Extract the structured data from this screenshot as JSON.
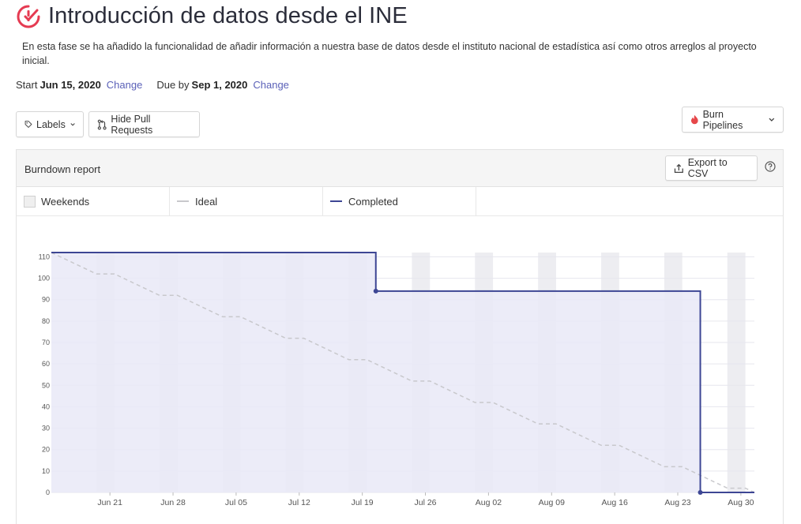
{
  "milestone": {
    "title": "Introducción de datos desde el INE",
    "description": "En esta fase se ha añadido la funcionalidad de añadir información a nuestra base de datos desde el instituto nacional de estadística así como otros arreglos al proyecto inicial.",
    "start_label": "Start",
    "start_date": "Jun 15, 2020",
    "due_label": "Due by",
    "due_date": "Sep 1, 2020",
    "change_label": "Change"
  },
  "toolbar": {
    "labels_button": "Labels",
    "hide_pr_button": "Hide Pull Requests",
    "burn_pipelines_button": "Burn Pipelines"
  },
  "report": {
    "title": "Burndown report",
    "export_button": "Export to CSV"
  },
  "legend": {
    "weekends": "Weekends",
    "ideal": "Ideal",
    "completed": "Completed"
  },
  "colors": {
    "accent": "#e53b52",
    "completed": "#3d4694",
    "completed_fill": "#e9e9f7",
    "ideal": "#c8c8cc",
    "weekend_band": "#dedee6",
    "link": "#5b61b8"
  },
  "chart_data": {
    "type": "line",
    "ylim": [
      0,
      112
    ],
    "y_ticks": [
      0,
      10,
      20,
      30,
      40,
      50,
      60,
      70,
      80,
      90,
      100,
      110
    ],
    "x_start": "2020-06-15",
    "x_end": "2020-09-01",
    "x_tick_labels": [
      "Jun 21",
      "Jun 28",
      "Jul 05",
      "Jul 12",
      "Jul 19",
      "Jul 26",
      "Aug 02",
      "Aug 09",
      "Aug 16",
      "Aug 23",
      "Aug 30"
    ],
    "x_tick_dates": [
      "2020-06-21",
      "2020-06-28",
      "2020-07-05",
      "2020-07-12",
      "2020-07-19",
      "2020-07-26",
      "2020-08-02",
      "2020-08-09",
      "2020-08-16",
      "2020-08-23",
      "2020-08-30"
    ],
    "weekends": [
      [
        "2020-06-20",
        "2020-06-21"
      ],
      [
        "2020-06-27",
        "2020-06-28"
      ],
      [
        "2020-07-04",
        "2020-07-05"
      ],
      [
        "2020-07-11",
        "2020-07-12"
      ],
      [
        "2020-07-18",
        "2020-07-19"
      ],
      [
        "2020-07-25",
        "2020-07-26"
      ],
      [
        "2020-08-01",
        "2020-08-02"
      ],
      [
        "2020-08-08",
        "2020-08-09"
      ],
      [
        "2020-08-15",
        "2020-08-16"
      ],
      [
        "2020-08-22",
        "2020-08-23"
      ],
      [
        "2020-08-29",
        "2020-08-30"
      ]
    ],
    "series": [
      {
        "name": "Ideal",
        "style": "dashed",
        "points": [
          [
            "2020-06-15",
            112
          ],
          [
            "2020-06-20",
            102
          ],
          [
            "2020-06-22",
            102
          ],
          [
            "2020-06-27",
            92
          ],
          [
            "2020-06-29",
            92
          ],
          [
            "2020-07-04",
            82
          ],
          [
            "2020-07-06",
            82
          ],
          [
            "2020-07-11",
            72
          ],
          [
            "2020-07-13",
            72
          ],
          [
            "2020-07-18",
            62
          ],
          [
            "2020-07-20",
            62
          ],
          [
            "2020-07-25",
            52
          ],
          [
            "2020-07-27",
            52
          ],
          [
            "2020-08-01",
            42
          ],
          [
            "2020-08-03",
            42
          ],
          [
            "2020-08-08",
            32
          ],
          [
            "2020-08-10",
            32
          ],
          [
            "2020-08-15",
            22
          ],
          [
            "2020-08-17",
            22
          ],
          [
            "2020-08-22",
            12
          ],
          [
            "2020-08-24",
            12
          ],
          [
            "2020-08-29",
            2
          ],
          [
            "2020-08-31",
            2
          ],
          [
            "2020-09-01",
            0
          ]
        ]
      },
      {
        "name": "Completed",
        "style": "step",
        "points": [
          [
            "2020-06-15",
            112
          ],
          [
            "2020-07-21",
            112
          ],
          [
            "2020-07-21",
            94
          ],
          [
            "2020-08-26",
            94
          ],
          [
            "2020-08-26",
            0
          ],
          [
            "2020-09-01",
            0
          ]
        ],
        "markers": [
          [
            "2020-07-21",
            94
          ],
          [
            "2020-08-26",
            0
          ]
        ]
      }
    ]
  }
}
